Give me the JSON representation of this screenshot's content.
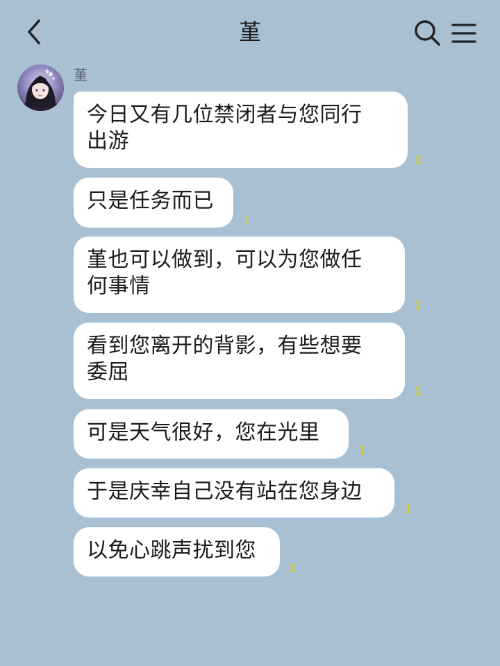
{
  "header": {
    "title": "堇"
  },
  "chat": {
    "sender_name": "堇",
    "messages": [
      {
        "text": "今日又有几位禁闭者与您同行\n出游",
        "read": "1"
      },
      {
        "text": "只是任务而已",
        "read": "1"
      },
      {
        "text": "堇也可以做到，可以为您做任\n何事情",
        "read": "1"
      },
      {
        "text": "看到您离开的背影，有些想要\n委屈",
        "read": "1"
      },
      {
        "text": "可是天气很好，您在光里",
        "read": "1"
      },
      {
        "text": "于是庆幸自己没有站在您身边",
        "read": "1"
      },
      {
        "text": "以免心跳声扰到您",
        "read": "1"
      }
    ]
  },
  "colors": {
    "background": "#a9bfd2",
    "bubble": "#ffffff",
    "read_indicator": "#e3d300"
  },
  "icons": {
    "back": "chevron-left-icon",
    "search": "search-icon",
    "menu": "hamburger-menu-icon"
  }
}
